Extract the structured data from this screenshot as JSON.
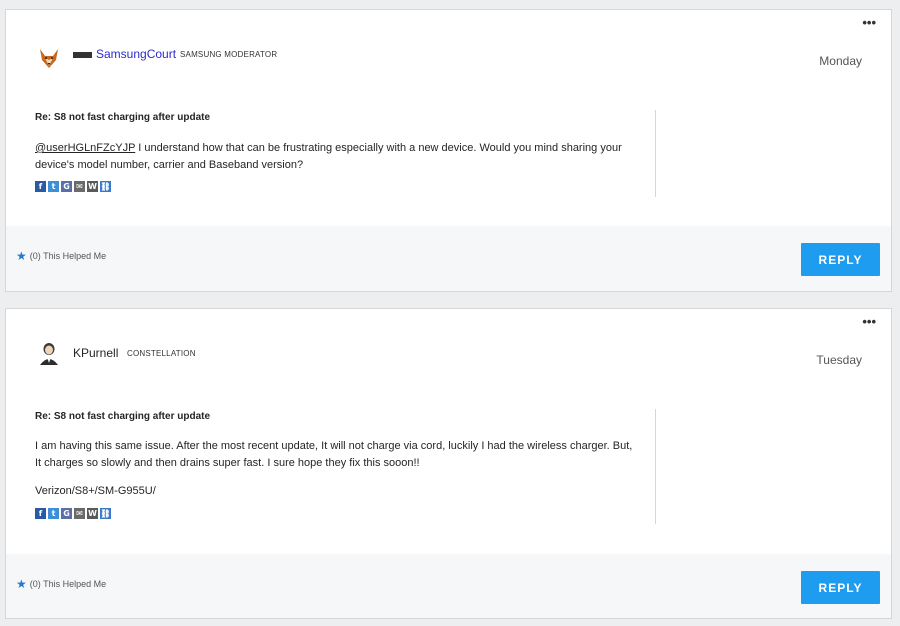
{
  "posts": [
    {
      "username": "SamsungCourt",
      "rank": "SAMSUNG MODERATOR",
      "date": "Monday",
      "subject": "Re: S8 not fast charging after update",
      "mention": "@userHGLnFZcYJP",
      "body": " I understand how that can be frustrating especially with a new device. Would you mind sharing your device's model number, carrier and Baseband version?",
      "helped": "(0) This Helped Me",
      "reply": "REPLY"
    },
    {
      "username": "KPurnell",
      "rank": "CONSTELLATION",
      "date": "Tuesday",
      "subject": "Re: S8 not fast charging after update",
      "body": "I am having this same issue.  After the most recent update, It will not charge via cord, luckily I had the wireless charger.  But, It charges so slowly and then drains super fast.  I sure hope they fix this sooon!!",
      "signature": "Verizon/S8+/SM-G955U/",
      "helped": "(0) This Helped Me",
      "reply": "REPLY"
    }
  ],
  "menu_glyph": "•••",
  "share_icons": [
    "facebook-icon",
    "twitter-icon",
    "google-icon",
    "email-icon",
    "wordpress-icon",
    "link-icon"
  ],
  "share_glyphs": [
    "f",
    "t",
    "G",
    "✉",
    "W",
    "⛓"
  ],
  "helped_icon": "★",
  "colors": {
    "accent": "#1e9cf0",
    "moderator_name": "#2b2bd0",
    "star": "#1f7bd6"
  }
}
